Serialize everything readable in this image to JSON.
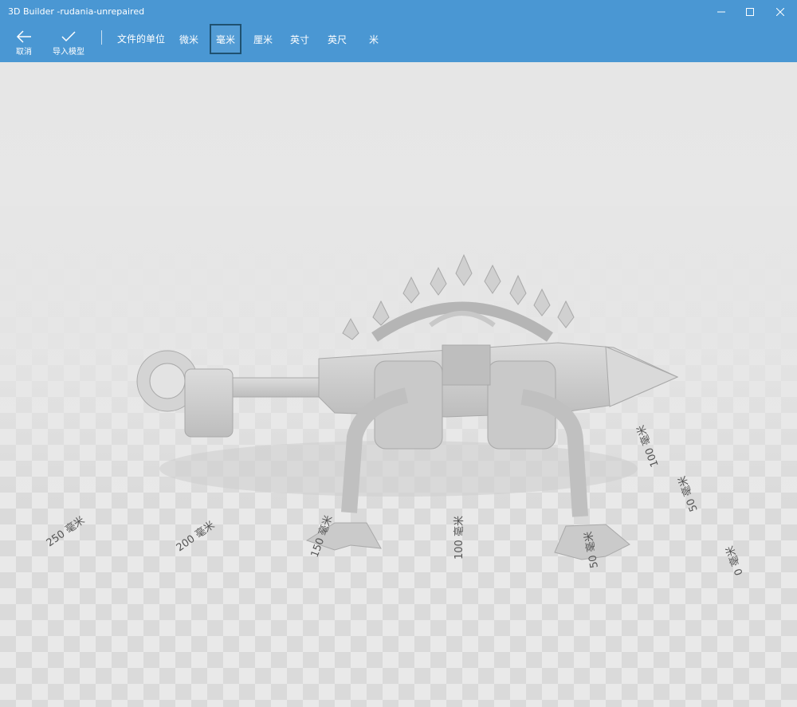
{
  "window": {
    "title": "3D Builder -rudania-unrepaired"
  },
  "toolbar": {
    "cancel_label": "取消",
    "import_label": "导入模型",
    "units_label": "文件的单位",
    "units": [
      "微米",
      "毫米",
      "厘米",
      "英寸",
      "英尺",
      "米"
    ],
    "selected_unit": "毫米"
  },
  "ruler": {
    "labels": [
      "250 毫米",
      "200 毫米",
      "150 毫米",
      "100 毫米",
      "50 毫米",
      "0 毫米",
      "50 毫米",
      "100 毫米"
    ]
  },
  "colors": {
    "accent": "#4a97d3",
    "model": "#cfcfcf",
    "floor_light": "#eaeaea",
    "floor_dark": "#d9d9d9"
  }
}
